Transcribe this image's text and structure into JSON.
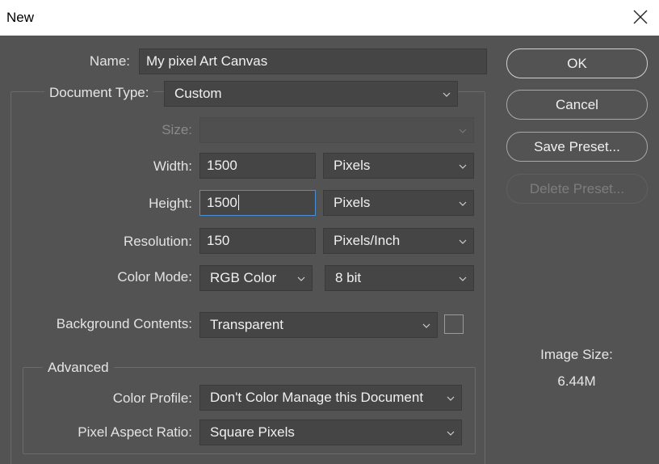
{
  "window": {
    "title": "New"
  },
  "form": {
    "name_label": "Name:",
    "name_value": "My pixel Art Canvas",
    "doc_type_label": "Document Type:",
    "doc_type_value": "Custom",
    "size_label": "Size:",
    "size_value": "",
    "width_label": "Width:",
    "width_value": "1500",
    "width_unit": "Pixels",
    "height_label": "Height:",
    "height_value": "1500",
    "height_unit": "Pixels",
    "resolution_label": "Resolution:",
    "resolution_value": "150",
    "resolution_unit": "Pixels/Inch",
    "color_mode_label": "Color Mode:",
    "color_mode_value": "RGB Color",
    "bit_depth_value": "8 bit",
    "bg_contents_label": "Background Contents:",
    "bg_contents_value": "Transparent"
  },
  "advanced": {
    "title": "Advanced",
    "color_profile_label": "Color Profile:",
    "color_profile_value": "Don't Color Manage this Document",
    "pixel_aspect_label": "Pixel Aspect Ratio:",
    "pixel_aspect_value": "Square Pixels"
  },
  "buttons": {
    "ok": "OK",
    "cancel": "Cancel",
    "save_preset": "Save Preset...",
    "delete_preset": "Delete Preset..."
  },
  "image_size": {
    "label": "Image Size:",
    "value": "6.44M"
  },
  "icons": {
    "close": "close-icon",
    "dropdown": "chevron-down-icon"
  }
}
